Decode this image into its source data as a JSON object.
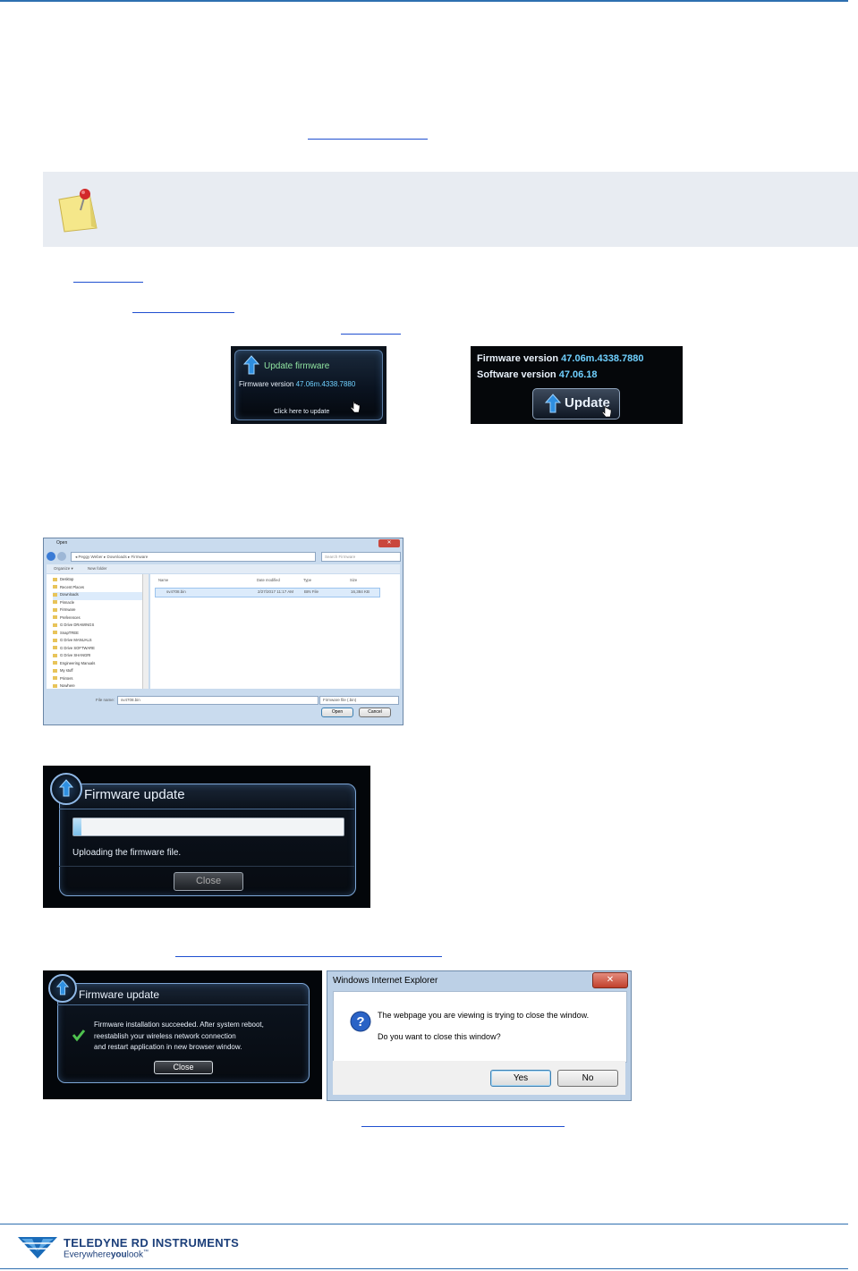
{
  "firmware_widget_small": {
    "title": "Update firmware",
    "version_label": "Firmware version",
    "version_value": "47.06m.4338.7880",
    "click_hint": "Click here to update"
  },
  "firmware_widget_large": {
    "firmware_label": "Firmware version",
    "firmware_value": "47.06m.4338.7880",
    "software_label": "Software version",
    "software_value": "47.06.18",
    "update_button": "Update"
  },
  "open_dialog": {
    "title": "Open",
    "address": "◂ Peggy Weber ▸ Downloads ▸ Firmware",
    "search_placeholder": "Search Firmware",
    "toolbar": {
      "organize": "Organize ▾",
      "new_folder": "New folder"
    },
    "tree_items": [
      "Desktop",
      "Recent Places",
      "Downloads",
      "Pinnacle",
      "Firmware",
      "Preferences",
      "G Drive DRAWINGS",
      "SnapTREE",
      "G Drive MANUALS",
      "G Drive SOFTWARE",
      "G Drive SHANGRI",
      "Engineering Manuals",
      "My stuff",
      "Printers",
      "Nowhere"
    ],
    "columns": [
      "Name",
      "Date modified",
      "Type",
      "Size"
    ],
    "files": [
      {
        "name": "sv4708.bin",
        "date": "2/27/2017 11:17 AM",
        "type": "BIN File",
        "size": "16,384 KB"
      }
    ],
    "filename_label": "File name:",
    "filename_value": "sv4708.bin",
    "filter_value": "Firmware file (.bin)",
    "open_button": "Open",
    "cancel_button": "Cancel"
  },
  "upload_dialog": {
    "title": "Firmware update",
    "status": "Uploading the firmware file.",
    "close_button": "Close",
    "progress_fraction": 0.03
  },
  "success_dialog": {
    "title": "Firmware update",
    "message_line1": "Firmware installation succeeded. After system reboot,",
    "message_line2": "reestablish your wireless network connection",
    "message_line3": "and restart application in new browser window.",
    "close_button": "Close"
  },
  "ie_dialog": {
    "title": "Windows Internet Explorer",
    "line1": "The webpage you are viewing is trying to close the window.",
    "line2": "Do you want to close this window?",
    "yes_button": "Yes",
    "no_button": "No",
    "close_glyph": "✕"
  },
  "footer": {
    "company": "TELEDYNE RD INSTRUMENTS",
    "tagline_1": "Everywhere",
    "tagline_2": "you",
    "tagline_3": "look",
    "tagline_tm": "™"
  },
  "colors": {
    "rule": "#2e6fb0",
    "link": "#1f4fd0",
    "note_bg": "#e8ecf2"
  }
}
